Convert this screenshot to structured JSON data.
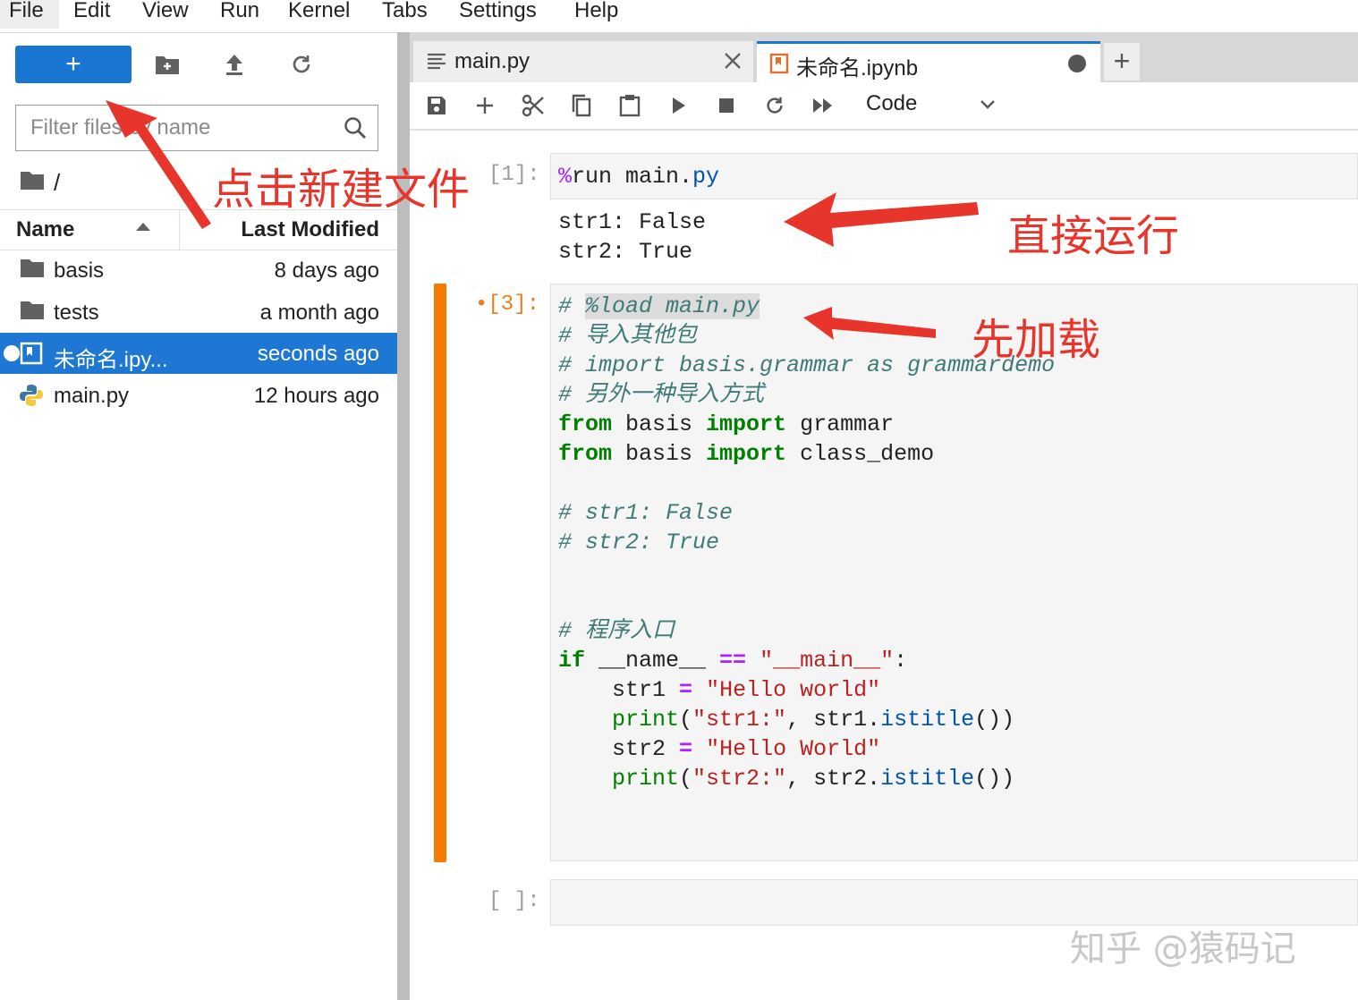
{
  "menu": [
    "File",
    "Edit",
    "View",
    "Run",
    "Kernel",
    "Tabs",
    "Settings",
    "Help"
  ],
  "sidebar": {
    "new_button_label": "+",
    "filter_placeholder": "Filter files by name",
    "breadcrumb": "/",
    "columns": {
      "name": "Name",
      "modified": "Last Modified"
    },
    "files": [
      {
        "name": "basis",
        "modified": "8 days ago",
        "icon": "folder-icon"
      },
      {
        "name": "tests",
        "modified": "a month ago",
        "icon": "folder-icon"
      },
      {
        "name": "未命名.ipy...",
        "modified": "seconds ago",
        "icon": "notebook-icon",
        "selected": true
      },
      {
        "name": "main.py",
        "modified": "12 hours ago",
        "icon": "python-icon"
      }
    ]
  },
  "tabs": [
    {
      "label": "main.py",
      "icon": "text-file-icon"
    },
    {
      "label": "未命名.ipynb",
      "icon": "notebook-icon",
      "active": true
    }
  ],
  "toolbar": {
    "cell_type": "Code"
  },
  "cells": [
    {
      "prompt": "[1]:",
      "input": "%run main.py",
      "output": [
        "str1: False",
        "str2: True"
      ]
    },
    {
      "prompt": "[3]:"
    },
    {
      "prompt": "[ ]:"
    }
  ],
  "annotations": {
    "new_file": "点击新建文件",
    "run_direct": "直接运行",
    "load_first": "先加载"
  },
  "watermark": "知乎 @猿码记",
  "colors": {
    "accent": "#1976d2",
    "active_cell": "#f57c00",
    "annotation": "#e8352b"
  }
}
